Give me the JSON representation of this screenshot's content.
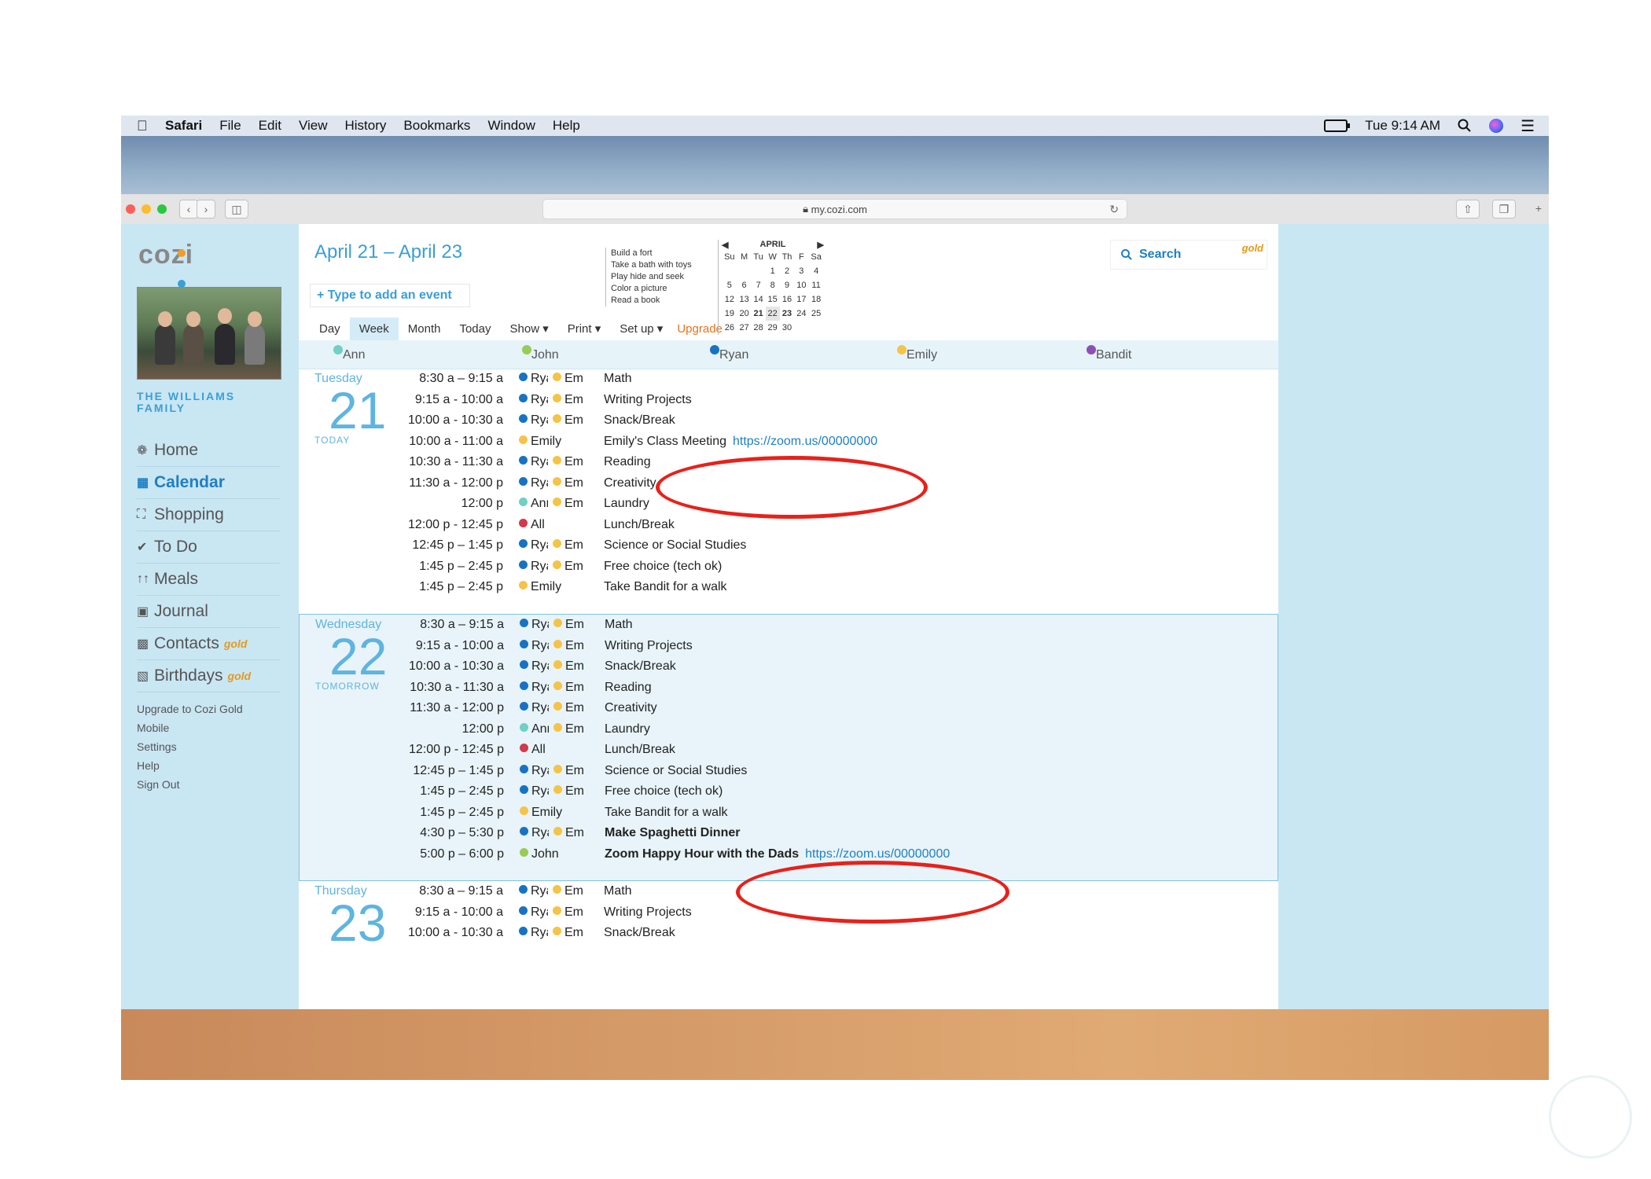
{
  "menubar": {
    "app": "Safari",
    "items": [
      "File",
      "Edit",
      "View",
      "History",
      "Bookmarks",
      "Window",
      "Help"
    ],
    "clock": "Tue 9:14 AM"
  },
  "browser": {
    "url": "my.cozi.com"
  },
  "sidebar": {
    "logo": "cozi",
    "family_name_line1": "THE WILLIAMS",
    "family_name_line2": "FAMILY",
    "nav": [
      {
        "label": "Home",
        "icon": "home-icon"
      },
      {
        "label": "Calendar",
        "icon": "calendar-icon"
      },
      {
        "label": "Shopping",
        "icon": "cart-icon"
      },
      {
        "label": "To Do",
        "icon": "check-icon"
      },
      {
        "label": "Meals",
        "icon": "utensils-icon"
      },
      {
        "label": "Journal",
        "icon": "camera-icon"
      },
      {
        "label": "Contacts",
        "icon": "contact-book-icon",
        "badge": "gold"
      },
      {
        "label": "Birthdays",
        "icon": "gift-icon",
        "badge": "gold"
      }
    ],
    "links": [
      "Upgrade to Cozi Gold",
      "Mobile",
      "Settings",
      "Help",
      "Sign Out"
    ]
  },
  "header": {
    "range": "April 21 – April 23",
    "add_event": "+ Type to add an event",
    "tabs": [
      "Day",
      "Week",
      "Month",
      "Today",
      "Show ▾",
      "Print ▾",
      "Set up ▾"
    ],
    "upgrade": "Upgrade",
    "search": "Search",
    "search_badge": "gold"
  },
  "todo": [
    "Build a fort",
    "Take a bath with toys",
    "Play hide and seek",
    "Color a picture",
    "Read a book"
  ],
  "minical": {
    "month": "APRIL",
    "days": [
      "Su",
      "M",
      "Tu",
      "W",
      "Th",
      "F",
      "Sa"
    ],
    "weeks": [
      [
        "",
        "",
        "",
        "1",
        "2",
        "3",
        "4"
      ],
      [
        "5",
        "6",
        "7",
        "8",
        "9",
        "10",
        "11"
      ],
      [
        "12",
        "13",
        "14",
        "15",
        "16",
        "17",
        "18"
      ],
      [
        "19",
        "20",
        "21",
        "22",
        "23",
        "24",
        "25"
      ],
      [
        "26",
        "27",
        "28",
        "29",
        "30",
        "",
        ""
      ]
    ]
  },
  "members": [
    {
      "name": "Ann",
      "color": "#6fd0c3"
    },
    {
      "name": "John",
      "color": "#98cc55"
    },
    {
      "name": "Ryan",
      "color": "#1773c2"
    },
    {
      "name": "Emily",
      "color": "#f5c347"
    },
    {
      "name": "Bandit",
      "color": "#8e4fb5"
    }
  ],
  "days": [
    {
      "name": "Tuesday",
      "num": "21",
      "sub": "TODAY",
      "events": [
        {
          "time": "8:30 a  –  9:15 a",
          "who": [
            "Ryan",
            "Em"
          ],
          "title": "Math"
        },
        {
          "time": "9:15 a - 10:00 a",
          "who": [
            "Ryan",
            "Em"
          ],
          "title": "Writing Projects"
        },
        {
          "time": "10:00 a - 10:30 a",
          "who": [
            "Ryan",
            "Em"
          ],
          "title": "Snack/Break"
        },
        {
          "time": "10:00 a - 11:00 a",
          "who": [
            "Emily"
          ],
          "title": "Emily's Class Meeting",
          "link": "https://zoom.us/00000000"
        },
        {
          "time": "10:30 a - 11:30 a",
          "who": [
            "Ryan",
            "Em"
          ],
          "title": "Reading"
        },
        {
          "time": "11:30 a - 12:00 p",
          "who": [
            "Ryan",
            "Em"
          ],
          "title": "Creativity"
        },
        {
          "time": "12:00 p",
          "who": [
            "Ann",
            "Em"
          ],
          "title": "Laundry"
        },
        {
          "time": "12:00 p - 12:45 p",
          "who": [
            "All"
          ],
          "title": "Lunch/Break"
        },
        {
          "time": "12:45 p  –  1:45 p",
          "who": [
            "Ryan",
            "Em"
          ],
          "title": "Science or Social Studies"
        },
        {
          "time": "1:45 p  –  2:45 p",
          "who": [
            "Ryan",
            "Em"
          ],
          "title": "Free choice (tech ok)"
        },
        {
          "time": "1:45 p  –  2:45 p",
          "who": [
            "Emily"
          ],
          "title": "Take Bandit for a walk"
        }
      ]
    },
    {
      "name": "Wednesday",
      "num": "22",
      "sub": "TOMORROW",
      "events": [
        {
          "time": "8:30 a  –  9:15 a",
          "who": [
            "Ryan",
            "Em"
          ],
          "title": "Math"
        },
        {
          "time": "9:15 a - 10:00 a",
          "who": [
            "Ryan",
            "Em"
          ],
          "title": "Writing Projects"
        },
        {
          "time": "10:00 a - 10:30 a",
          "who": [
            "Ryan",
            "Em"
          ],
          "title": "Snack/Break"
        },
        {
          "time": "10:30 a - 11:30 a",
          "who": [
            "Ryan",
            "Em"
          ],
          "title": "Reading"
        },
        {
          "time": "11:30 a - 12:00 p",
          "who": [
            "Ryan",
            "Em"
          ],
          "title": "Creativity"
        },
        {
          "time": "12:00 p",
          "who": [
            "Ann",
            "Em"
          ],
          "title": "Laundry"
        },
        {
          "time": "12:00 p - 12:45 p",
          "who": [
            "All"
          ],
          "title": "Lunch/Break"
        },
        {
          "time": "12:45 p  –  1:45 p",
          "who": [
            "Ryan",
            "Em"
          ],
          "title": "Science or Social Studies"
        },
        {
          "time": "1:45 p  –  2:45 p",
          "who": [
            "Ryan",
            "Em"
          ],
          "title": "Free choice (tech ok)"
        },
        {
          "time": "1:45 p  –  2:45 p",
          "who": [
            "Emily"
          ],
          "title": "Take Bandit for a walk"
        },
        {
          "time": "4:30 p  –  5:30 p",
          "who": [
            "Ryan",
            "Em"
          ],
          "title": "Make Spaghetti Dinner",
          "bold": true
        },
        {
          "time": "5:00 p  –  6:00 p",
          "who": [
            "John"
          ],
          "title": "Zoom Happy Hour with the Dads",
          "bold": true,
          "link": "https://zoom.us/00000000"
        }
      ]
    },
    {
      "name": "Thursday",
      "num": "23",
      "sub": "",
      "events": [
        {
          "time": "8:30 a  –  9:15 a",
          "who": [
            "Ryan",
            "Em"
          ],
          "title": "Math"
        },
        {
          "time": "9:15 a - 10:00 a",
          "who": [
            "Ryan",
            "Em"
          ],
          "title": "Writing Projects"
        },
        {
          "time": "10:00 a - 10:30 a",
          "who": [
            "Ryan",
            "Em"
          ],
          "title": "Snack/Break"
        }
      ]
    }
  ],
  "colors": {
    "ryan": "#1773c2",
    "em": "#f5c347",
    "ann": "#6fd0c3",
    "all": "#d2394d",
    "john": "#98cc55",
    "accent": "#3a9fd6",
    "annotation": "#e8211a"
  }
}
